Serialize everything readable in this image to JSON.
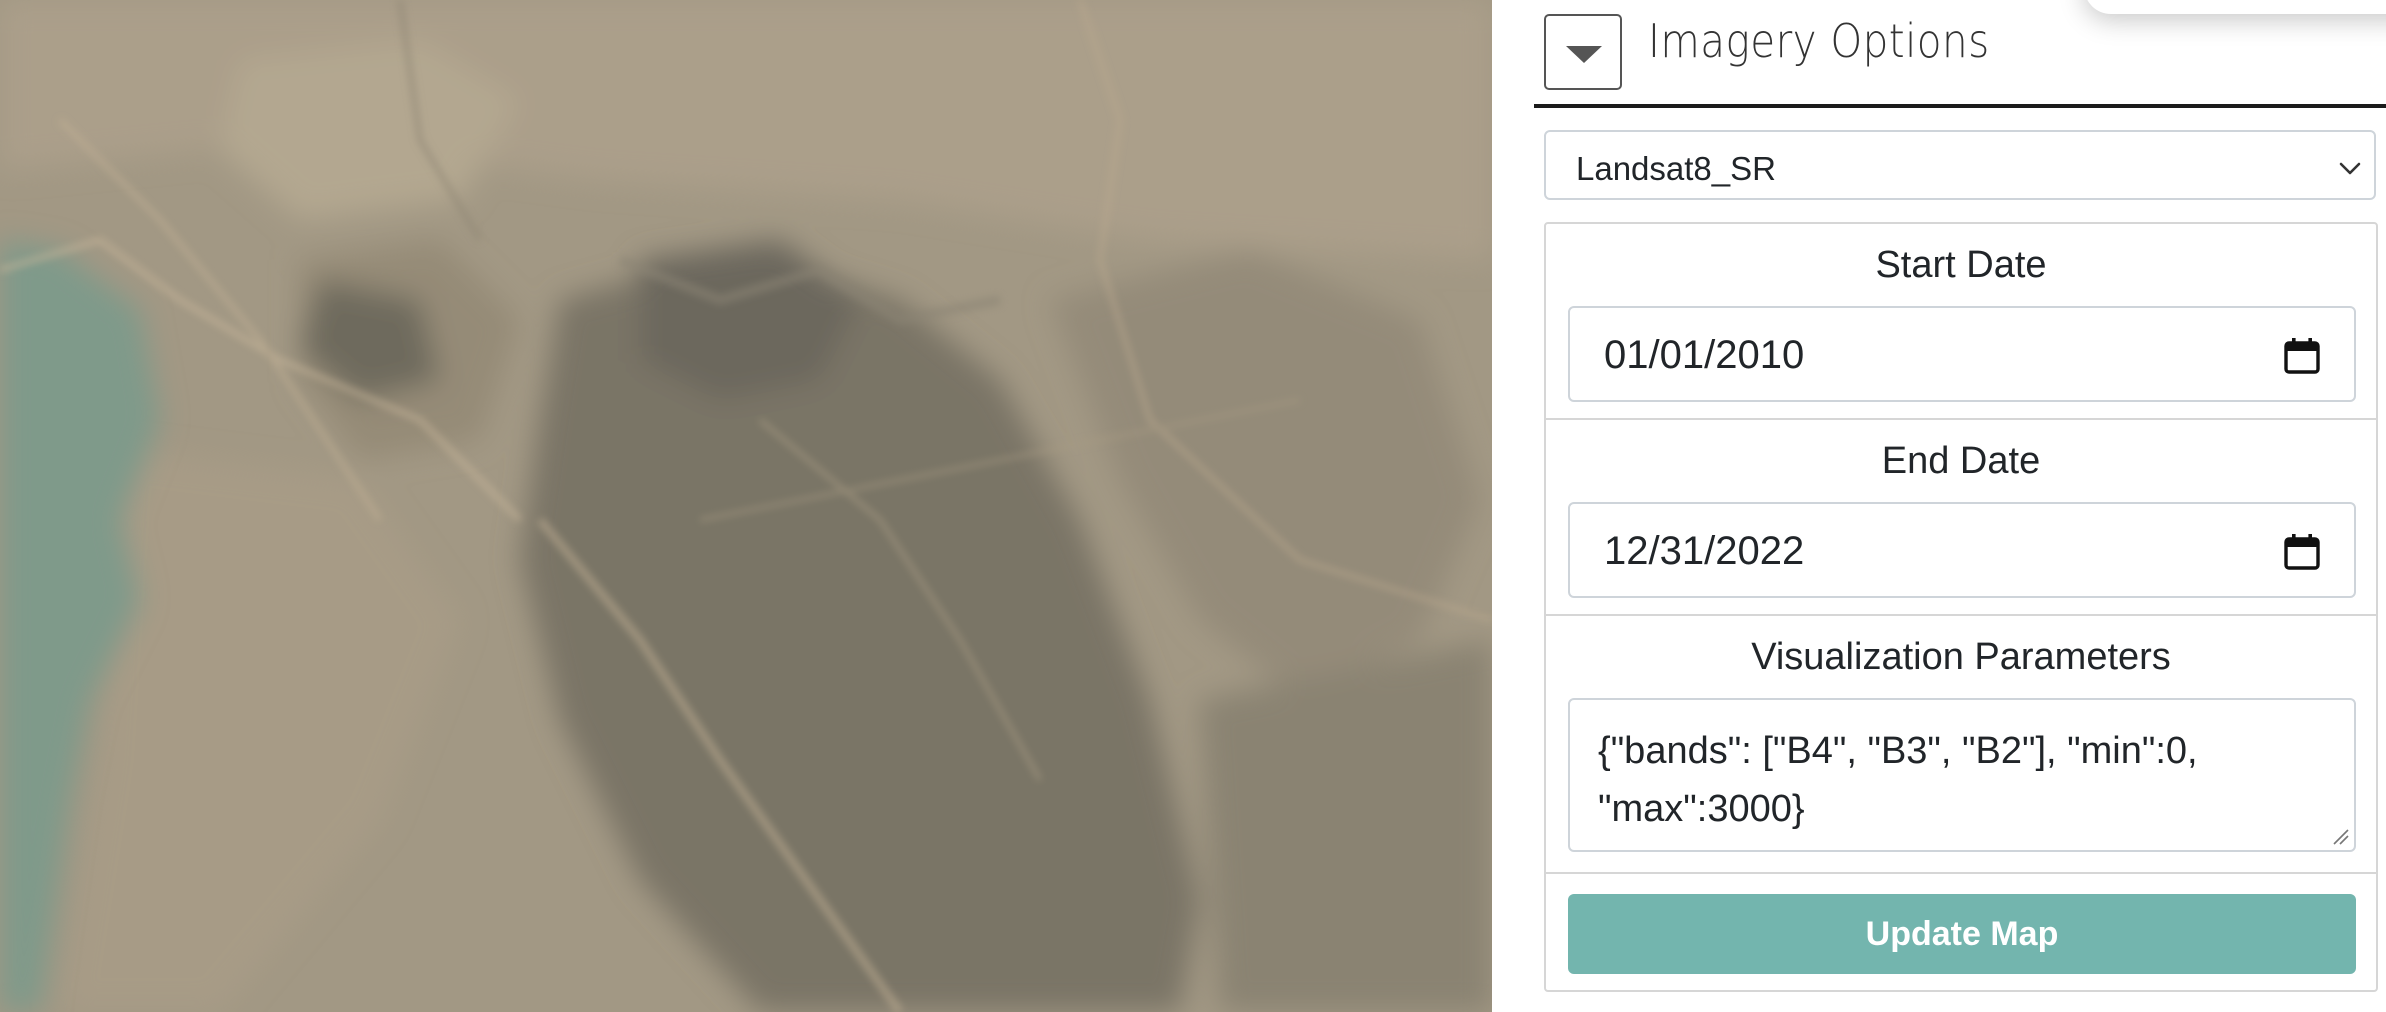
{
  "panel": {
    "title": "Imagery Options",
    "collapse_icon": "caret-down-icon",
    "dataset_select": {
      "value": "Landsat8_SR"
    },
    "start_date": {
      "label": "Start Date",
      "value": "01/01/2010",
      "icon": "calendar-icon"
    },
    "end_date": {
      "label": "End Date",
      "value": "12/31/2022",
      "icon": "calendar-icon"
    },
    "vis_params": {
      "label": "Visualization Parameters",
      "value": "{\"bands\": [\"B4\", \"B3\", \"B2\"], \"min\":0, \"max\":3000}"
    },
    "update_button": {
      "label": "Update Map"
    }
  },
  "colors": {
    "button_accent": "#73b5ae",
    "header_rule": "#1b1b1b",
    "water": "#7f9a8a",
    "terrain_light": "#b2a691",
    "terrain_dark": "#6f6a5e"
  }
}
